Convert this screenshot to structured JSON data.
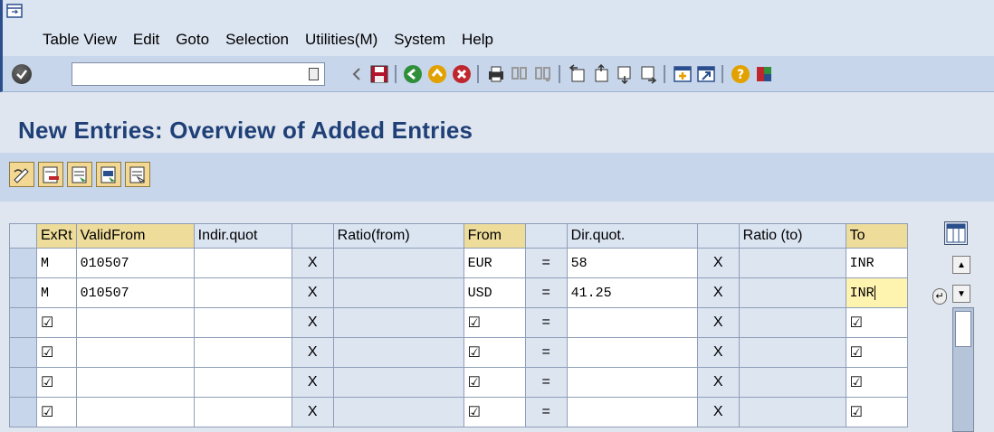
{
  "menubar": {
    "icon": "menu-exit-icon",
    "items": [
      "Table View",
      "Edit",
      "Goto",
      "Selection",
      "Utilities(M)",
      "System",
      "Help"
    ]
  },
  "toolbar": {
    "command_value": "",
    "icons": [
      "enter-check-icon",
      "command-dropdown-icon",
      "back-arrow-icon",
      "save-icon",
      "back-icon",
      "exit-icon",
      "cancel-icon",
      "print-icon",
      "find-icon",
      "find-next-icon",
      "first-page-icon",
      "previous-page-icon",
      "next-page-icon",
      "last-page-icon",
      "create-session-icon",
      "shortcut-icon",
      "help-icon",
      "customize-layout-icon"
    ]
  },
  "title": "New Entries: Overview of Added Entries",
  "app_toolbar": {
    "icons": [
      "change-display-icon",
      "delete-entry-icon",
      "select-all-icon",
      "select-block-icon",
      "deselect-all-icon"
    ]
  },
  "table": {
    "headers": [
      "ExRt",
      "ValidFrom",
      "Indir.quot",
      "",
      "Ratio(from)",
      "From",
      "",
      "Dir.quot.",
      "",
      "Ratio (to)",
      "To"
    ],
    "rows": [
      [
        "M",
        "010507",
        "",
        "X",
        "",
        "EUR",
        "=",
        "58",
        "X",
        "",
        "INR"
      ],
      [
        "M",
        "010507",
        "",
        "X",
        "",
        "USD",
        "=",
        "41.25",
        "X",
        "",
        "INR"
      ],
      [
        "☑",
        "",
        "",
        "X",
        "",
        "☑",
        "=",
        "",
        "X",
        "",
        "☑"
      ],
      [
        "☑",
        "",
        "",
        "X",
        "",
        "☑",
        "=",
        "",
        "X",
        "",
        "☑"
      ],
      [
        "☑",
        "",
        "",
        "X",
        "",
        "☑",
        "=",
        "",
        "X",
        "",
        "☑"
      ],
      [
        "☑",
        "",
        "",
        "X",
        "",
        "☑",
        "=",
        "",
        "X",
        "",
        "☑"
      ]
    ]
  },
  "colors": {
    "title": "#1f3f77",
    "key_header": "#eedc9a",
    "toolbar_bg": "#c7d6ea"
  }
}
